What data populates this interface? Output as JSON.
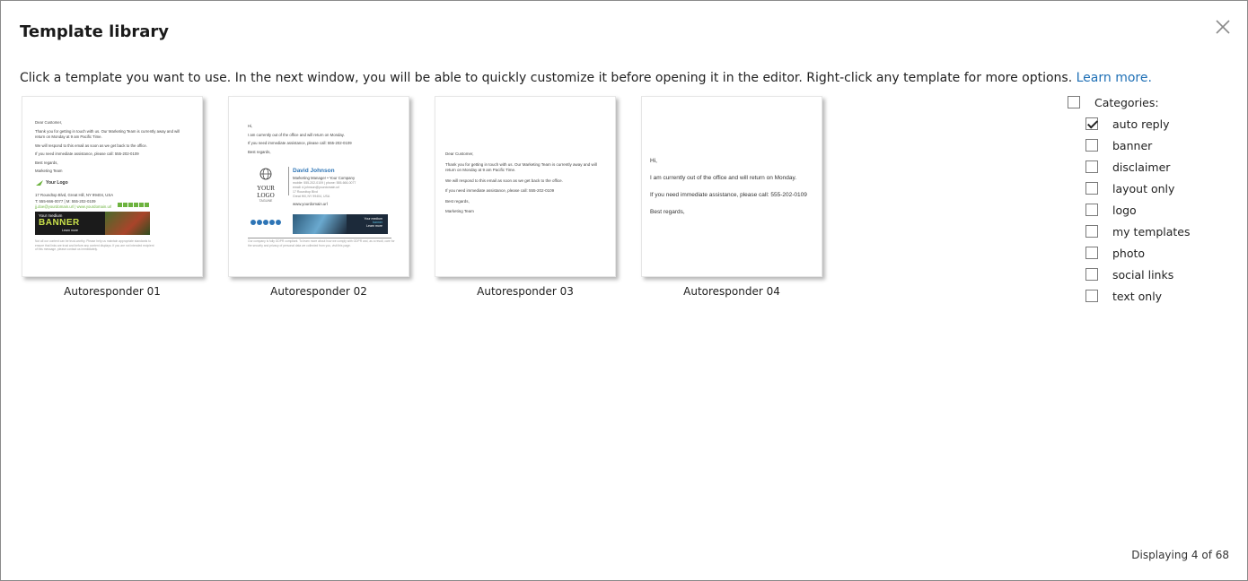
{
  "dialog": {
    "title": "Template library",
    "intro": "Click a template you want to use. In the next window, you will be able to quickly customize it before opening it in the editor. Right-click any template for more options.",
    "learn_more": "Learn more.",
    "footer": "Displaying 4 of 68"
  },
  "templates": [
    {
      "label": "Autoresponder 01",
      "preview": {
        "greeting": "Dear Customer,",
        "body1": "Thank you for getting in touch with us. Our Marketing Team is currently away and will return on Monday at 9 am Pacific Time.",
        "body2": "We will respond to this email as soon as we get back to the office.",
        "body3": "If you need immediate assistance, please call: 555-202-0109",
        "closing": "Best regards,",
        "team": "Marketing Team",
        "logo": "Your Logo",
        "address": "17 Roundtop Blvd, Great Hill, NY 99404, USA",
        "phones": "T: 555-666-0077 | M: 555-202-0109",
        "email": "jj.doe@yourdomain.url | www.yourdomain.url",
        "banner_small": "Your medium",
        "banner_big": "BANNER",
        "banner_cta": "Learn more",
        "disclaimer": "Not all our content can be trust-worthy. Please help us maintain appropriate standards to ensure that links are trust and before any content displays. If you are not intended recipient of this message, please contact us immediately."
      }
    },
    {
      "label": "Autoresponder 02",
      "preview": {
        "greeting": "Hi,",
        "body1": "I am currently out of the office and will return on Monday.",
        "body2": "If you need immediate assistance, please call: 555-202-0109",
        "closing": "Best regards,",
        "logo": "YOUR LOGO",
        "logo_sub": "TAGLINE",
        "name": "David Johnson",
        "position": "Marketing Manager • Your Company",
        "contact1": "mobile: 555-202-0109 | phone: 555-666-0077",
        "contact2": "email: d.johnson@yourdomain.url",
        "contact3": "17 Roundtop Blvd",
        "contact4": "Great Hill, NY 99404, USA",
        "website": "www.yourdomain.url",
        "banner_small": "Your medium",
        "banner_big": "banner",
        "banner_cta": "Learn more",
        "disclaimer": "Our company is fully GDPR compliant. To learn more about how we comply with GDPR and, as a result, care for the security and privacy of personal data we collected from you, visit this page."
      }
    },
    {
      "label": "Autoresponder 03",
      "preview": {
        "greeting": "Dear Customer,",
        "body1": "Thank you for getting in touch with us. Our Marketing Team is currently away and will return on Monday at 9 am Pacific Time.",
        "body2": "We will respond to this email as soon as we get back to the office.",
        "body3": "If you need immediate assistance, please call: 555-202-0109",
        "closing": "Best regards,",
        "team": "Marketing Team"
      }
    },
    {
      "label": "Autoresponder 04",
      "preview": {
        "greeting": "Hi,",
        "body1": "I am currently out of the office and will return on Monday.",
        "body2": "If you need immediate assistance, please call: 555-202-0109",
        "closing": "Best regards,"
      }
    }
  ],
  "categories": {
    "header": "Categories:",
    "header_checked": false,
    "items": [
      {
        "label": "auto reply",
        "checked": true
      },
      {
        "label": "banner",
        "checked": false
      },
      {
        "label": "disclaimer",
        "checked": false
      },
      {
        "label": "layout only",
        "checked": false
      },
      {
        "label": "logo",
        "checked": false
      },
      {
        "label": "my templates",
        "checked": false
      },
      {
        "label": "photo",
        "checked": false
      },
      {
        "label": "social links",
        "checked": false
      },
      {
        "label": "text only",
        "checked": false
      }
    ]
  },
  "colors": {
    "link": "#1e6fb5",
    "accent_green": "#6db33f",
    "name_blue": "#2e75b6",
    "banner_dark": "#1c2a3a"
  },
  "icons": {
    "close": "close-icon",
    "checkbox_checked": "checkmark-icon"
  }
}
